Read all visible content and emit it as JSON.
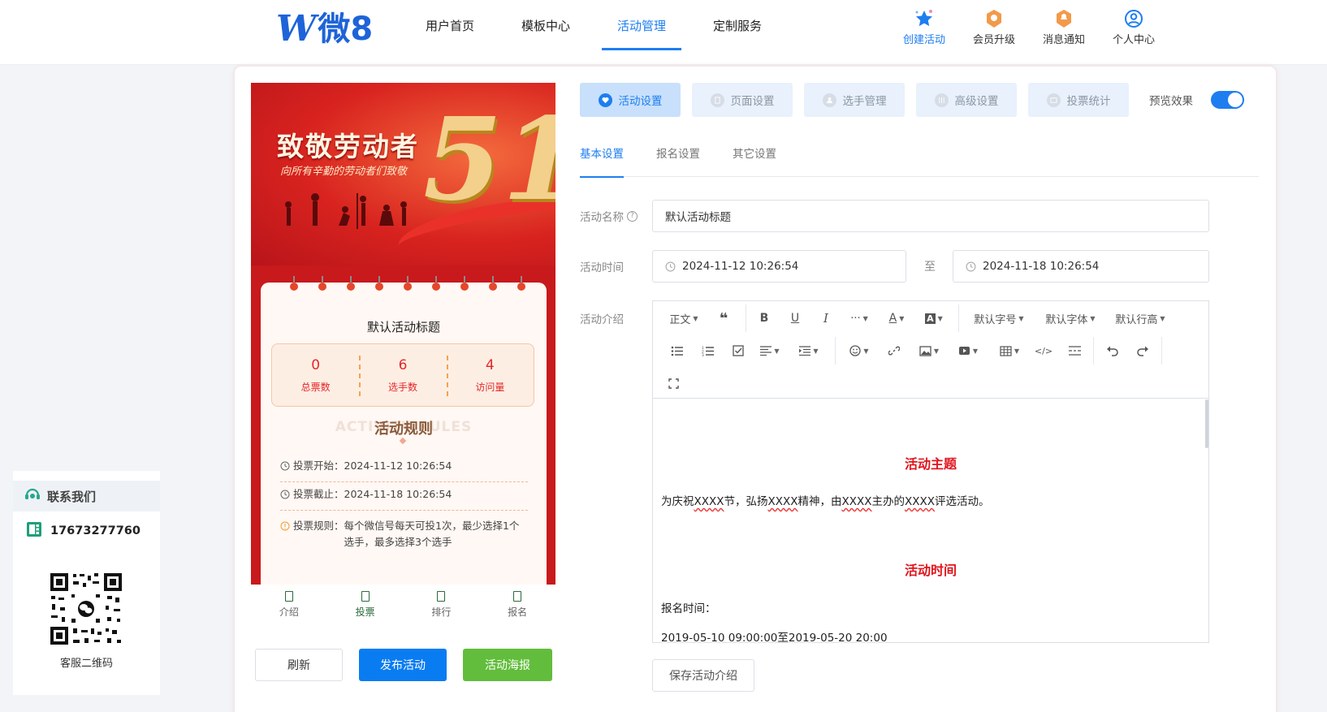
{
  "logo": {
    "mark": "W",
    "text": "微8"
  },
  "nav": [
    {
      "label": "用户首页"
    },
    {
      "label": "模板中心"
    },
    {
      "label": "活动管理",
      "active": true
    },
    {
      "label": "定制服务"
    }
  ],
  "tools": [
    {
      "label": "创建活动",
      "icon": "star-icon"
    },
    {
      "label": "会员升级",
      "icon": "vip-badge-icon"
    },
    {
      "label": "消息通知",
      "icon": "bell-badge-icon"
    },
    {
      "label": "个人中心",
      "icon": "user-circle-icon"
    }
  ],
  "preview_phone": {
    "banner": {
      "title": "致敬劳动者",
      "subtitle": "向所有辛勤的劳动者们致敬",
      "big_number": "51"
    },
    "activity_title": "默认活动标题",
    "stats": [
      {
        "value": "0",
        "label": "总票数"
      },
      {
        "value": "6",
        "label": "选手数"
      },
      {
        "value": "4",
        "label": "访问量"
      }
    ],
    "rules_heading_bg": "ACTIVITY RULES",
    "rules_heading": "活动规则",
    "rules": [
      {
        "key": "投票开始：",
        "value": "2024-11-12 10:26:54"
      },
      {
        "key": "投票截止：",
        "value": "2024-11-18 10:26:54"
      },
      {
        "key": "投票规则：",
        "value": "每个微信号每天可投1次，最少选择1个选手，最多选择3个选手"
      }
    ],
    "tabbar": [
      {
        "label": "介绍"
      },
      {
        "label": "投票",
        "active": true
      },
      {
        "label": "排行"
      },
      {
        "label": "报名"
      }
    ]
  },
  "buttons": {
    "refresh": "刷新",
    "publish": "发布活动",
    "poster": "活动海报",
    "save_intro": "保存活动介绍"
  },
  "main_tabs": [
    {
      "label": "活动设置",
      "active": true
    },
    {
      "label": "页面设置"
    },
    {
      "label": "选手管理"
    },
    {
      "label": "高级设置"
    },
    {
      "label": "投票统计"
    }
  ],
  "preview_toggle": {
    "label": "预览效果",
    "on": true
  },
  "sub_tabs": [
    {
      "label": "基本设置",
      "active": true
    },
    {
      "label": "报名设置"
    },
    {
      "label": "其它设置"
    }
  ],
  "form": {
    "name_label": "活动名称",
    "name_value": "默认活动标题",
    "time_label": "活动时间",
    "time_start": "2024-11-12 10:26:54",
    "time_sep": "至",
    "time_end": "2024-11-18 10:26:54",
    "intro_label": "活动介绍"
  },
  "editor": {
    "toolbar": {
      "paragraph": "正文",
      "font_size": "默认字号",
      "font_family": "默认字体",
      "line_height": "默认行高"
    },
    "content": {
      "heading1": "活动主题",
      "para1_parts": [
        "为庆祝",
        "XXXX",
        "节，弘扬",
        "XXXX",
        "精神，由",
        "XXXX",
        "主办的",
        "XXXX",
        "评选活动。"
      ],
      "heading2": "活动时间",
      "para2": "报名时间：",
      "para3": "2019-05-10 09:00:00至2019-05-20 20:00"
    }
  },
  "contact": {
    "title": "联系我们",
    "phone": "17673277760",
    "qr_label": "客服二维码"
  },
  "colors": {
    "primary": "#1e7ef0",
    "publish": "#0a7cf2",
    "poster": "#62bd3c",
    "festive_red": "#d8231f"
  }
}
